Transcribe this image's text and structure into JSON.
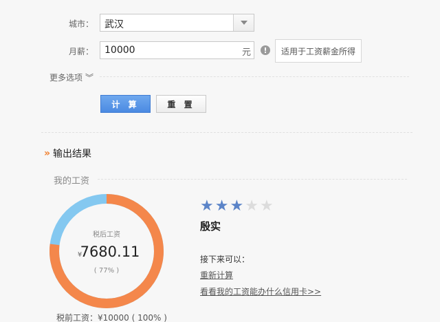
{
  "form": {
    "city_label": "城市：",
    "city_value": "武汉",
    "salary_label": "月薪：",
    "salary_value": "10000",
    "salary_unit": "元",
    "info_icon": "!",
    "tip": "适用于工资薪金所得",
    "more_options": "更多选项",
    "more_chevron": "︾",
    "calc_button": "计 算",
    "reset_button": "重 置"
  },
  "result": {
    "section_marker": "»",
    "section_title": "输出结果",
    "my_salary_title": "我的工资",
    "donut_label": "税后工资",
    "currency": "¥",
    "after_tax": "7680.11",
    "after_tax_percent_text": "( 77% )",
    "after_tax_fraction": 0.77,
    "before_tax_text": "税前工资：¥10000 ( 100% )",
    "rating": 3,
    "rating_max": 5,
    "level": "殷实",
    "next_label": "接下来可以：",
    "link_recalc": "重新计算",
    "link_credit": "看看我的工资能办什么信用卡>>"
  },
  "colors": {
    "after_tax": "#f4874b",
    "tax": "#84c8f0",
    "star_on": "#5b84c8",
    "star_off": "#dcdcdc",
    "primary": "#4b8ae2",
    "marker": "#f08030"
  },
  "icons": {
    "select_arrow": "chevron-down-icon",
    "info": "info-icon",
    "star": "star-icon"
  }
}
